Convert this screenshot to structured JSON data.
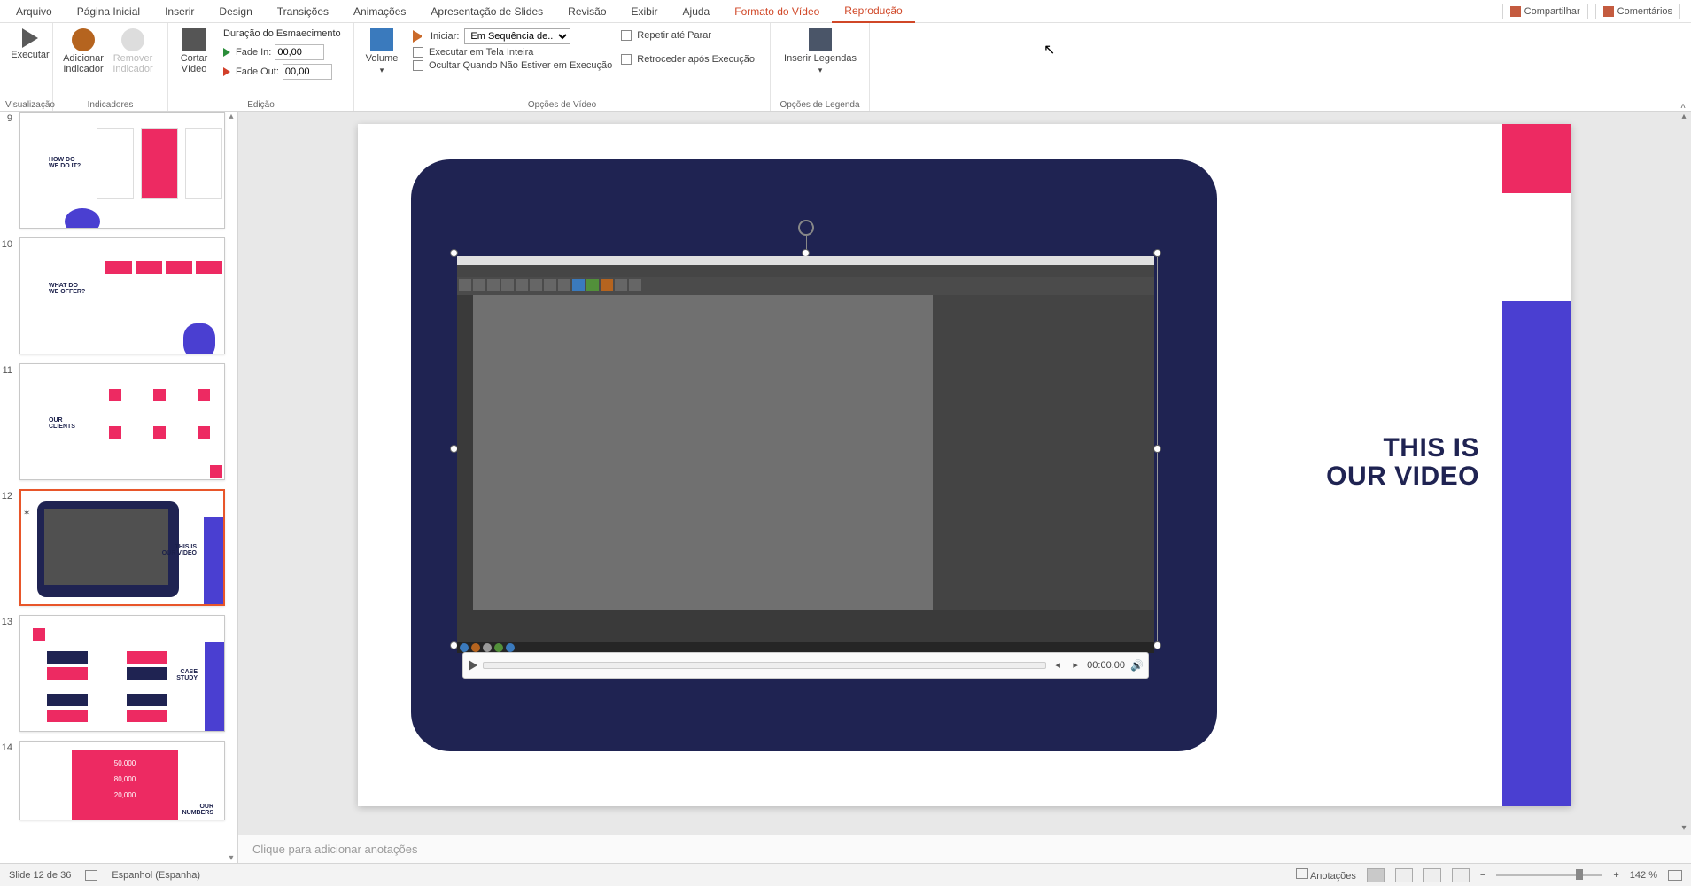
{
  "menu": {
    "items": [
      "Arquivo",
      "Página Inicial",
      "Inserir",
      "Design",
      "Transições",
      "Animações",
      "Apresentação de Slides",
      "Revisão",
      "Exibir",
      "Ajuda"
    ],
    "context1": "Formato do Vídeo",
    "context2": "Reprodução",
    "share": "Compartilhar",
    "comments": "Comentários"
  },
  "ribbon": {
    "preview": {
      "execute": "Executar",
      "group": "Visualização"
    },
    "bookmarks": {
      "add": "Adicionar Indicador",
      "remove": "Remover Indicador",
      "group": "Indicadores"
    },
    "editing": {
      "trim": "Cortar Vídeo",
      "fade_title": "Duração do Esmaecimento",
      "fade_in_label": "Fade In:",
      "fade_out_label": "Fade Out:",
      "fade_in_val": "00,00",
      "fade_out_val": "00,00",
      "group": "Edição"
    },
    "video_opts": {
      "volume": "Volume",
      "start_label": "Iniciar:",
      "start_value": "Em Sequência de...",
      "fullscreen": "Executar em Tela Inteira",
      "hide": "Ocultar Quando Não Estiver em Execução",
      "loop": "Repetir até Parar",
      "rewind": "Retroceder após Execução",
      "group": "Opções de Vídeo"
    },
    "captions": {
      "insert": "Inserir Legendas",
      "group": "Opções de Legenda"
    }
  },
  "thumbs": {
    "n9": "9",
    "n10": "10",
    "n11": "11",
    "n12": "12",
    "n13": "13",
    "n14": "14",
    "t9_txt": "HOW DO\nWE DO IT?",
    "t10_txt": "WHAT DO\nWE OFFER?",
    "t11_txt": "OUR\nCLIENTS",
    "t12_txt": "THIS IS\nOUR VIDEO",
    "t13_txt": "CASE\nSTUDY",
    "t14_a": "50,000",
    "t14_b": "80,000",
    "t14_c": "20,000",
    "t14_txt": "OUR\nNUMBERS"
  },
  "slide": {
    "title_l1": "THIS IS",
    "title_l2": "OUR VIDEO",
    "media_time": "00:00,00"
  },
  "notes_placeholder": "Clique para adicionar anotações",
  "status": {
    "slide_info": "Slide 12 de 36",
    "language": "Espanhol (Espanha)",
    "notes": "Anotações",
    "zoom": "142 %"
  }
}
